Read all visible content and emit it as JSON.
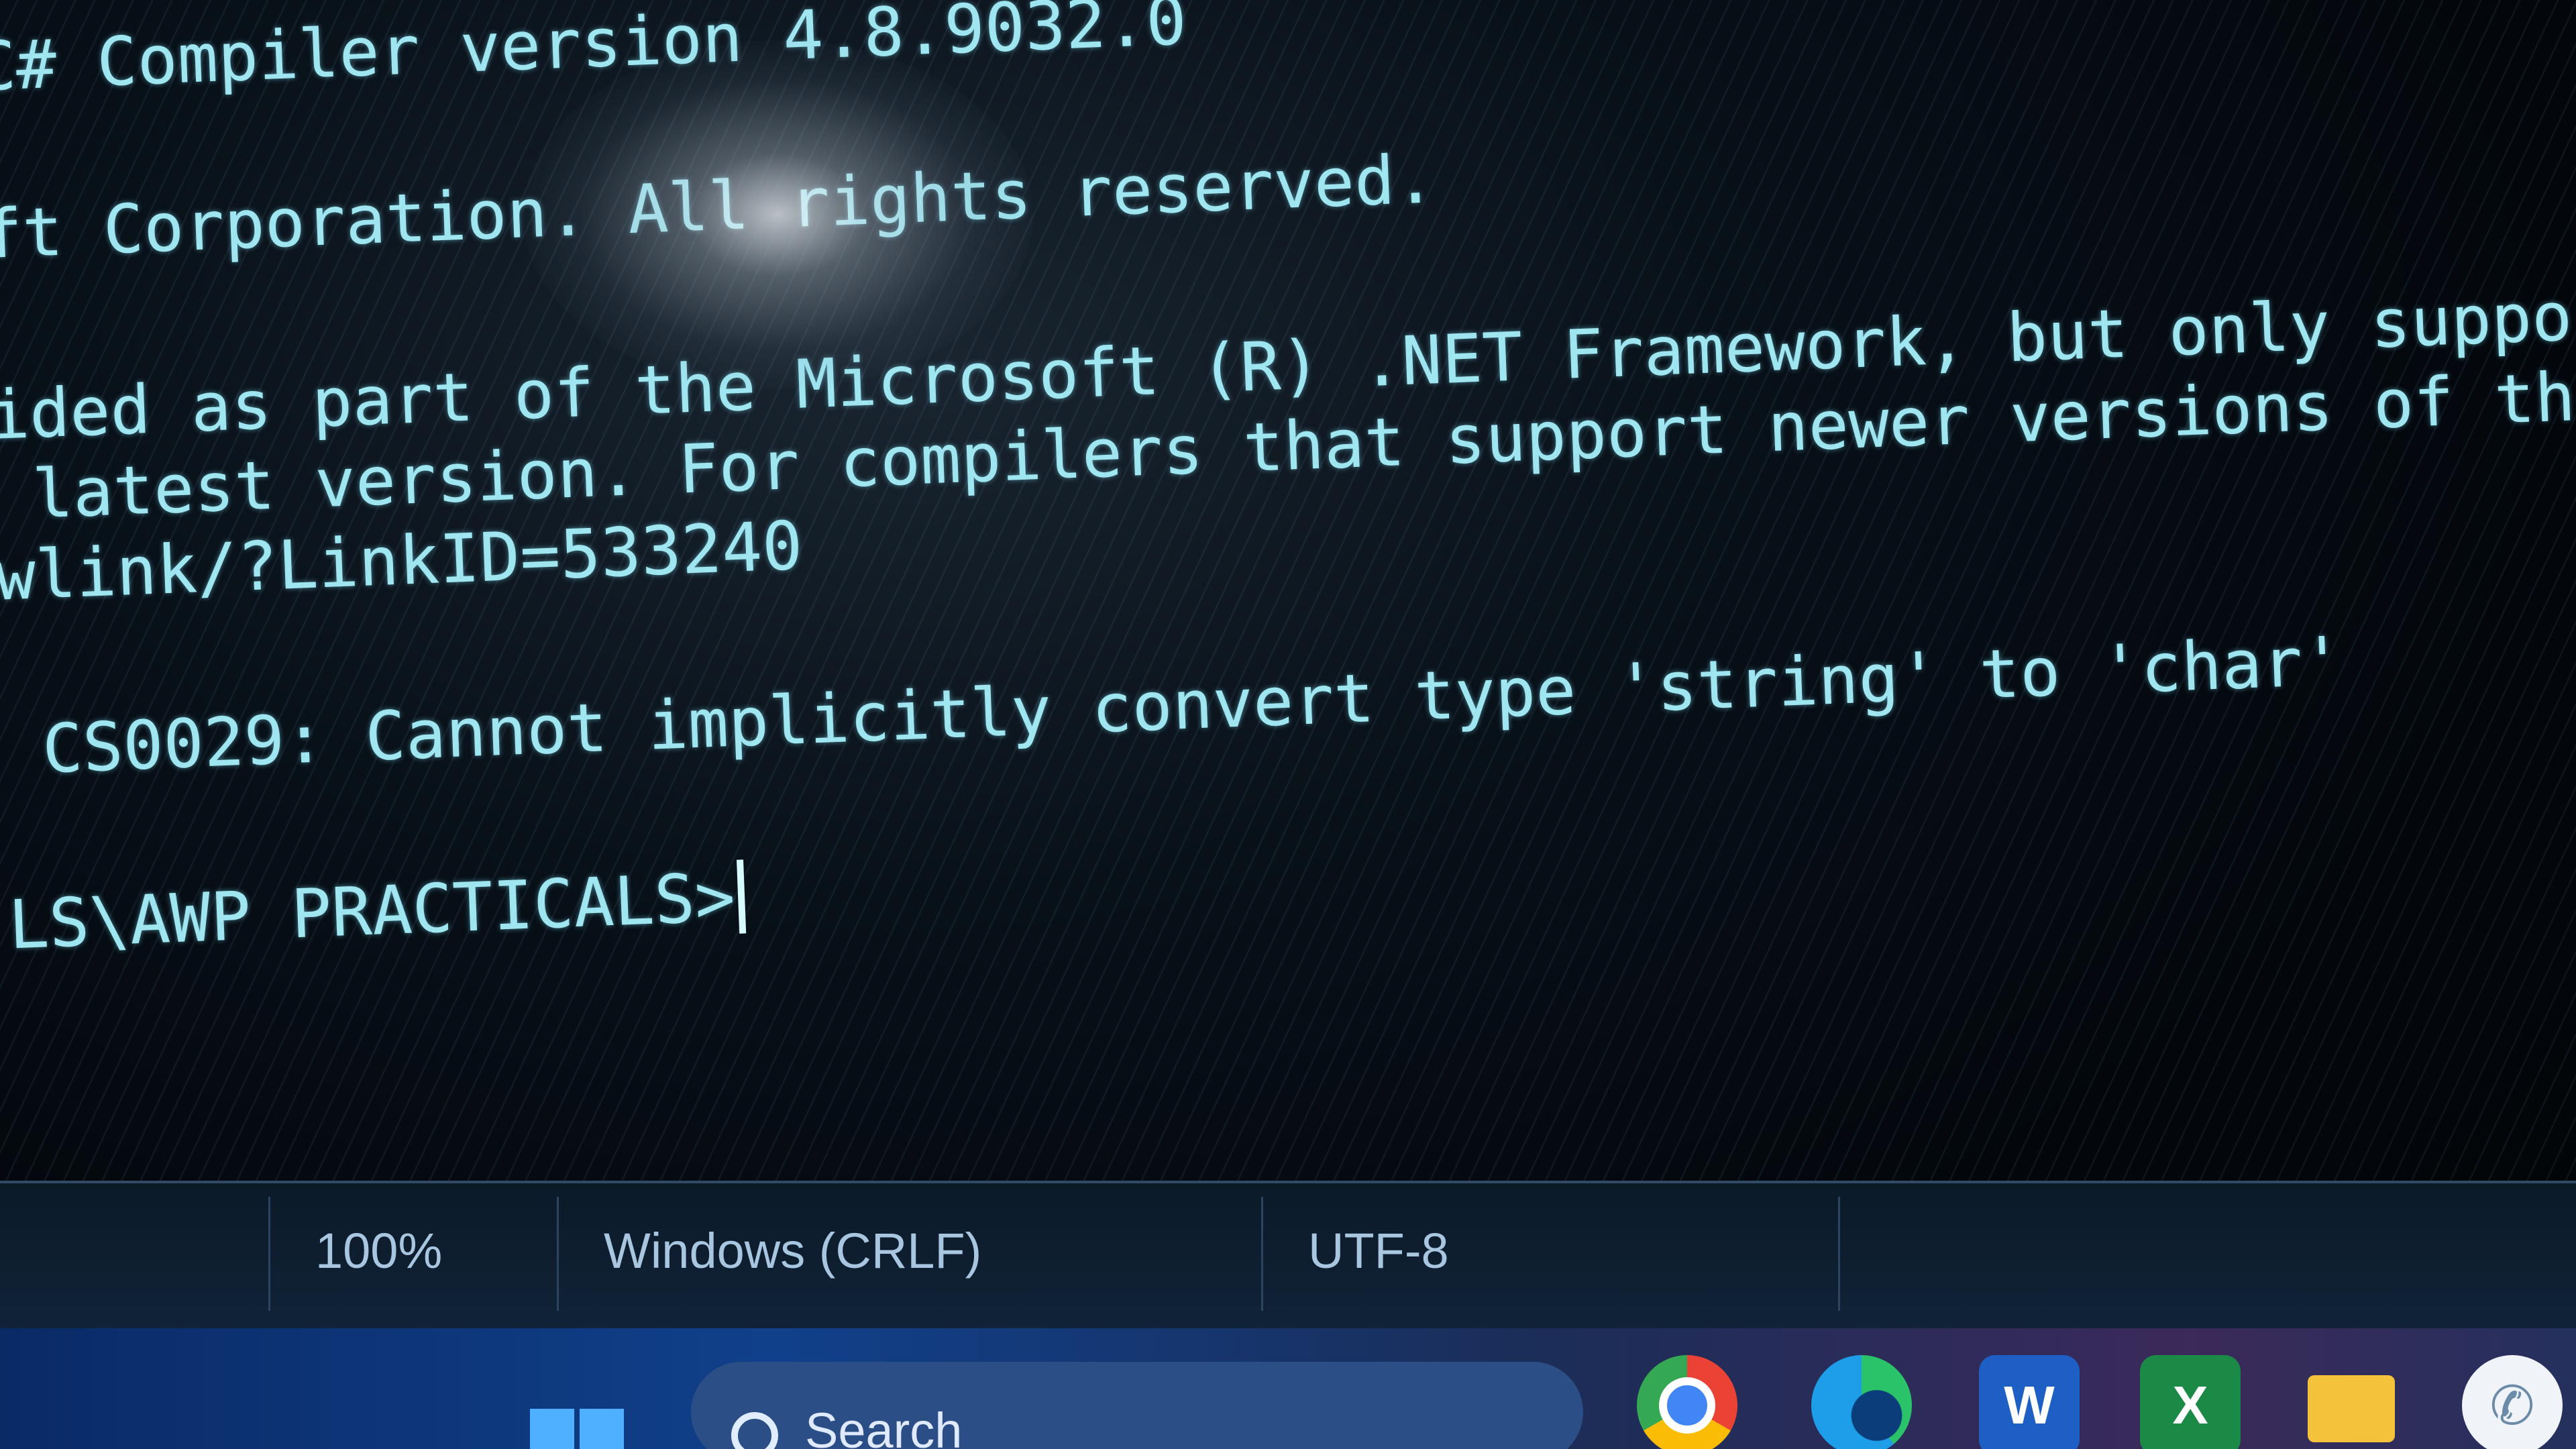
{
  "console": {
    "lines": [
      "C# Compiler version 4.8.9032.0",
      "ft Corporation. All rights reserved.",
      "ided as part of the Microsoft (R) .NET Framework, but only supports la",
      " latest version. For compilers that support newer versions of the C# p",
      "wlink/?LinkID=533240",
      " CS0029: Cannot implicitly convert type 'string' to 'char'",
      "LS\\AWP PRACTICALS>"
    ]
  },
  "statusbar": {
    "zoom": "100%",
    "line_endings": "Windows (CRLF)",
    "encoding": "UTF-8"
  },
  "taskbar": {
    "search_label": "Search",
    "apps": [
      {
        "name": "Google Chrome",
        "icon": "chrome-icon"
      },
      {
        "name": "Microsoft Edge",
        "icon": "edge-icon"
      },
      {
        "name": "Microsoft Word",
        "icon": "word-icon",
        "glyph": "W"
      },
      {
        "name": "Microsoft Excel",
        "icon": "excel-icon",
        "glyph": "X"
      },
      {
        "name": "File Explorer",
        "icon": "folder-icon"
      },
      {
        "name": "WhatsApp",
        "icon": "whatsapp-icon",
        "glyph": "✆"
      }
    ]
  },
  "colors": {
    "console_text": "#9fe6f0",
    "console_bg": "#03070c",
    "statusbar_bg": "#0c1a28",
    "taskbar_accent": "#10408a"
  }
}
